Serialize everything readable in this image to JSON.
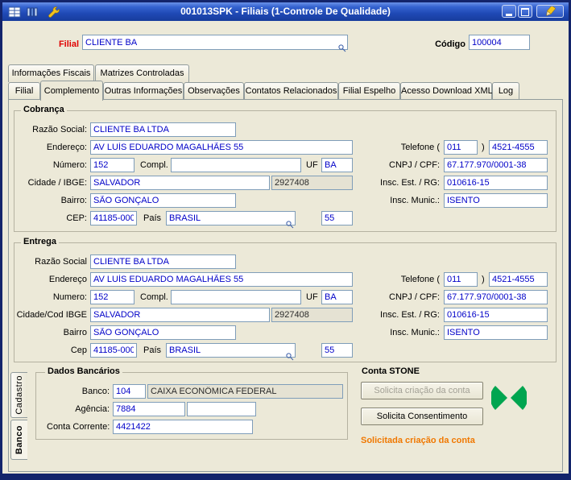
{
  "titlebar": {
    "title": "001013SPK - Filiais (1-Controle De Qualidade)"
  },
  "header": {
    "filial_label": "Filial",
    "filial_value": "CLIENTE BA",
    "codigo_label": "Código",
    "codigo_value": "100004"
  },
  "tabs": {
    "top": [
      "Informações Fiscais",
      "Matrizes Controladas"
    ],
    "main": [
      "Filial",
      "Complemento",
      "Outras Informações",
      "Observações",
      "Contatos Relacionados",
      "Filial Espelho",
      "Acesso Download XML",
      "Log"
    ],
    "active_main": "Complemento"
  },
  "cobranca": {
    "title": "Cobrança",
    "labels": {
      "razao": "Razão Social:",
      "endereco": "Endereço:",
      "numero": "Número:",
      "compl": "Compl.",
      "uf": "UF",
      "cidade": "Cidade / IBGE:",
      "bairro": "Bairro:",
      "cep": "CEP:",
      "pais": "País",
      "telefone": "Telefone (",
      "paren": ")",
      "cnpj": "CNPJ / CPF:",
      "insc_est": "Insc. Est. / RG:",
      "insc_mun": "Insc. Munic.:"
    },
    "values": {
      "razao": "CLIENTE BA LTDA",
      "endereco": "AV LUÍS EDUARDO MAGALHÃES 55",
      "numero": "152",
      "compl": "",
      "uf": "BA",
      "cidade": "SALVADOR",
      "ibge": "2927408",
      "bairro": "SÃO GONÇALO",
      "cep": "41185-000",
      "pais": "BRASIL",
      "ddi": "55",
      "ddd": "011",
      "fone": "4521-4555",
      "cnpj": "67.177.970/0001-38",
      "insc_est": "010616-15",
      "insc_mun": "ISENTO"
    }
  },
  "entrega": {
    "title": "Entrega",
    "labels": {
      "razao": "Razão Social",
      "endereco": "Endereço",
      "numero": "Numero:",
      "compl": "Compl.",
      "uf": "UF",
      "cidade": "Cidade/Cod IBGE",
      "bairro": "Bairro",
      "cep": "Cep",
      "pais": "País",
      "telefone": "Telefone (",
      "paren": ")",
      "cnpj": "CNPJ / CPF:",
      "insc_est": "Insc. Est. / RG:",
      "insc_mun": "Insc. Munic.:"
    },
    "values": {
      "razao": "CLIENTE BA LTDA",
      "endereco": "AV LUÍS EDUARDO MAGALHÃES 55",
      "numero": "152",
      "compl": "",
      "uf": "BA",
      "cidade": "SALVADOR",
      "ibge": "2927408",
      "bairro": "SÃO GONÇALO",
      "cep": "41185-000",
      "pais": "BRASIL",
      "ddi": "55",
      "ddd": "011",
      "fone": "4521-4555",
      "cnpj": "67.177.970/0001-38",
      "insc_est": "010616-15",
      "insc_mun": "ISENTO"
    }
  },
  "side_tabs": {
    "cadastro": "Cadastro",
    "banco": "Banco",
    "active": "Banco"
  },
  "dados_bancarios": {
    "title": "Dados Bancários",
    "labels": {
      "banco": "Banco:",
      "agencia": "Agência:",
      "conta": "Conta Corrente:"
    },
    "values": {
      "banco_codigo": "104",
      "banco_nome": "CAIXA ECONÔMICA FEDERAL",
      "agencia": "7884",
      "agencia_compl": "",
      "conta": "4421422"
    }
  },
  "conta_stone": {
    "title": "Conta STONE",
    "botao_criacao": "Solicita criação da conta",
    "botao_consentimento": "Solicita Consentimento",
    "status": "Solicitada criação da conta"
  },
  "icons": {
    "titlebar_left": [
      "grid-icon",
      "columns-icon",
      "wrench-icon"
    ],
    "titlebar_right": [
      "minimize-icon",
      "maximize-icon",
      "pencil-icon"
    ],
    "field_lookup": "magnifier-icon",
    "stone": "stone-arrows-icon"
  },
  "colors": {
    "value_blue": "#0000C8",
    "filial_red": "#E00000",
    "status_orange": "#F07800",
    "stone_green": "#00A550",
    "titlebar_blue": "#2a55c0",
    "form_bg": "#ECE9D8"
  }
}
